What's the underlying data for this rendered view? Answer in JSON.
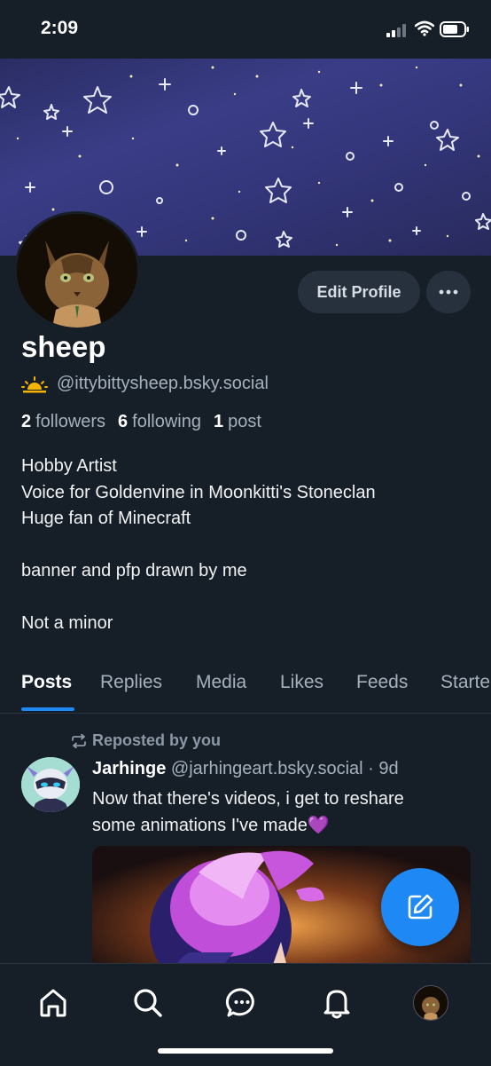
{
  "status_bar": {
    "time": "2:09"
  },
  "profile": {
    "display_name": "sheep",
    "handle": "@ittybittysheep.bsky.social",
    "edit_button": "Edit Profile",
    "followers_count": "2",
    "followers_label": "followers",
    "following_count": "6",
    "following_label": "following",
    "posts_count": "1",
    "posts_label": "post",
    "bio": [
      "Hobby Artist",
      "Voice for Goldenvine in Moonkitti's Stoneclan",
      "Huge fan of Minecraft",
      "",
      "banner and pfp drawn by me",
      "",
      "Not a minor"
    ]
  },
  "tabs": [
    {
      "label": "Posts",
      "active": true
    },
    {
      "label": "Replies",
      "active": false
    },
    {
      "label": "Media",
      "active": false
    },
    {
      "label": "Likes",
      "active": false
    },
    {
      "label": "Feeds",
      "active": false
    },
    {
      "label": "Starte",
      "active": false
    }
  ],
  "post": {
    "repost_label": "Reposted by you",
    "author_name": "Jarhinge",
    "author_handle": "@jarhingeart.bsky.social",
    "separator": " · ",
    "age": "9d",
    "text_line1": "Now that there's videos, i get to reshare",
    "text_line2": "some animations I've made💜"
  },
  "bottom_nav": [
    "home-icon",
    "search-icon",
    "chat-icon",
    "bell-icon",
    "profile-avatar"
  ],
  "colors": {
    "accent": "#1e88f5",
    "background": "#161e27",
    "button": "#27313d"
  }
}
